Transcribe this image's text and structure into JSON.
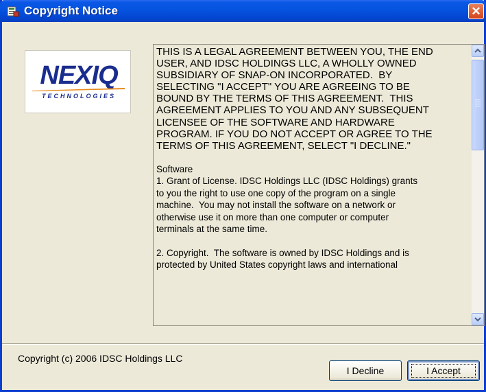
{
  "window": {
    "title": "Copyright Notice",
    "colors": {
      "titlebar": "#0553df",
      "close": "#d2441b",
      "dialog": "#ece9d8"
    },
    "icons": {
      "title": "app-icon",
      "close": "close-icon"
    }
  },
  "logo": {
    "word": "NEXIQ",
    "subtitle": "TECHNOLOGIES"
  },
  "agreement": {
    "upper_lines": [
      "THIS IS A LEGAL AGREEMENT BETWEEN YOU, THE END",
      "USER, AND IDSC HOLDINGS LLC, A WHOLLY OWNED",
      "SUBSIDIARY OF SNAP-ON INCORPORATED.  BY",
      "SELECTING \"I ACCEPT\" YOU ARE AGREEING TO BE",
      "BOUND BY THE TERMS OF THIS AGREEMENT.  THIS",
      "AGREEMENT APPLIES TO YOU AND ANY SUBSEQUENT",
      "LICENSEE OF THE SOFTWARE AND HARDWARE",
      "PROGRAM. IF YOU DO NOT ACCEPT OR AGREE TO THE",
      "TERMS OF THIS AGREEMENT, SELECT \"I DECLINE.\""
    ],
    "section1_lines": [
      "Software",
      "1. Grant of License. IDSC Holdings LLC (IDSC Holdings) grants",
      "to you the right to use one copy of the program on a single",
      "machine.  You may not install the software on a network or",
      "otherwise use it on more than one computer or computer",
      "terminals at the same time."
    ],
    "section2_lines": [
      "2. Copyright.  The software is owned by IDSC Holdings and is",
      "protected by United States copyright laws and international"
    ]
  },
  "footer": {
    "copyright": "Copyright (c) 2006 IDSC Holdings LLC",
    "decline_label": "I Decline",
    "accept_label": "I Accept"
  }
}
